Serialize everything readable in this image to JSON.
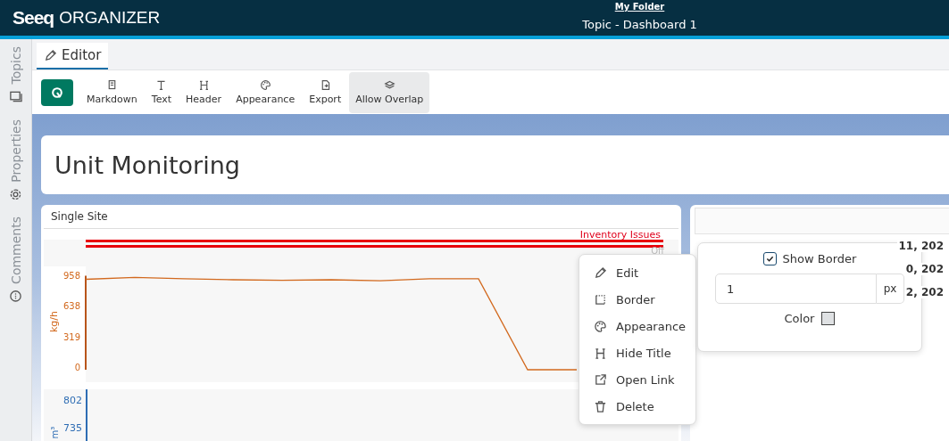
{
  "header": {
    "logo": "Seeq",
    "product": "ORGANIZER",
    "folder_link": "My Folder",
    "title": "Topic - Dashboard 1"
  },
  "side_tabs": [
    {
      "label": "Topics"
    },
    {
      "label": "Properties"
    },
    {
      "label": "Comments"
    }
  ],
  "editor_tabs": [
    {
      "label": "Editor",
      "selected": true
    }
  ],
  "toolbar": [
    {
      "label": "Markdown",
      "selected": false
    },
    {
      "label": "Text",
      "selected": false
    },
    {
      "label": "Header",
      "selected": false
    },
    {
      "label": "Appearance",
      "selected": false
    },
    {
      "label": "Export",
      "selected": false
    },
    {
      "label": "Allow Overlap",
      "selected": true
    }
  ],
  "title_card": {
    "title": "Unit Monitoring"
  },
  "site_card": {
    "title": "Single Site",
    "event_labels": [
      "Inventory Issues",
      "Off"
    ],
    "chart_data": {
      "type": "line",
      "ylabel": "kg/h",
      "yticks": [
        0,
        319,
        638,
        958
      ],
      "ylim": [
        0,
        1000
      ],
      "series": [
        {
          "color": "#d2691e",
          "values": [
            940,
            960,
            945,
            935,
            930,
            935,
            925,
            945,
            945,
            0,
            0
          ]
        }
      ]
    },
    "second_axis": {
      "label": "m³",
      "ticks": [
        "802",
        "735"
      ]
    }
  },
  "table_card": {
    "cells": [
      "11, 202",
      "0, 202",
      "2, 202"
    ]
  },
  "context_menu": [
    {
      "label": "Edit"
    },
    {
      "label": "Border"
    },
    {
      "label": "Appearance"
    },
    {
      "label": "Hide Title"
    },
    {
      "label": "Open Link"
    },
    {
      "label": "Delete"
    }
  ],
  "border_popup": {
    "show_border": {
      "label": "Show Border",
      "checked": true
    },
    "width": {
      "value": "1",
      "unit": "px"
    },
    "color_label": "Color",
    "color": "#dfe1e3"
  }
}
